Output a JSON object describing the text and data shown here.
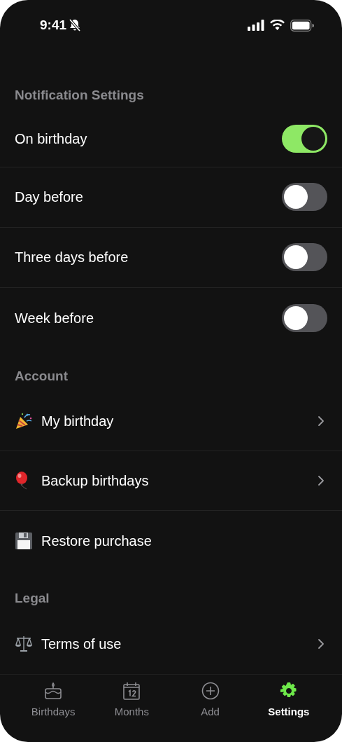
{
  "status_bar": {
    "time": "9:41"
  },
  "sections": [
    {
      "title": "Notification Settings",
      "rows": [
        {
          "kind": "toggle",
          "label": "On birthday",
          "on": true
        },
        {
          "kind": "toggle",
          "label": "Day before",
          "on": false
        },
        {
          "kind": "toggle",
          "label": "Three days before",
          "on": false
        },
        {
          "kind": "toggle",
          "label": "Week before",
          "on": false
        }
      ]
    },
    {
      "title": "Account",
      "rows": [
        {
          "kind": "link",
          "label": "My birthday"
        },
        {
          "kind": "link",
          "label": "Backup birthdays"
        },
        {
          "kind": "action",
          "label": "Restore purchase"
        }
      ]
    },
    {
      "title": "Legal",
      "rows": [
        {
          "kind": "link",
          "label": "Terms of use"
        }
      ]
    }
  ],
  "tabs": [
    {
      "label": "Birthdays",
      "selected": false
    },
    {
      "label": "Months",
      "selected": false
    },
    {
      "label": "Add",
      "selected": false
    },
    {
      "label": "Settings",
      "selected": true
    }
  ]
}
